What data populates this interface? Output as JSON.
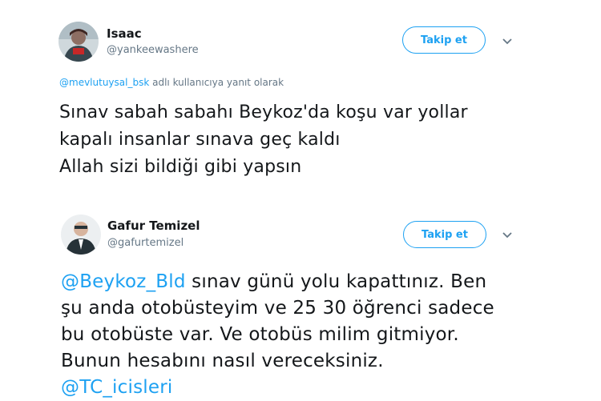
{
  "tweet1": {
    "name": "Isaac",
    "handle": "@yankeewashere",
    "follow_label": "Takip et",
    "reply_mention": "@mevlutuysal_bsk",
    "reply_suffix": " adlı kullanıcıya yanıt olarak",
    "lines": [
      "Sınav sabah sabahı Beykoz'da koşu var yollar",
      "kapalı insanlar sınava geç kaldı",
      "Allah sizi bildiği gibi yapsın"
    ]
  },
  "tweet2": {
    "name": "Gafur Temizel",
    "handle": "@gafurtemizel",
    "follow_label": "Takip et",
    "mention_start": "@Beykoz_Bld",
    "line1_rest": " sınav günü yolu kapattınız. Ben",
    "lines": [
      "şu anda otobüsteyim ve 25 30 öğrenci sadece",
      "bu otobüste var. Ve otobüs milim gitmiyor.",
      "Bunun hesabını nasıl vereceksiniz."
    ],
    "mention_end": "@TC_icisleri"
  },
  "colors": {
    "accent": "#1da1f2",
    "text": "#14171a",
    "muted": "#657786"
  },
  "icons": {
    "dropdown": "chevron-down-icon"
  }
}
